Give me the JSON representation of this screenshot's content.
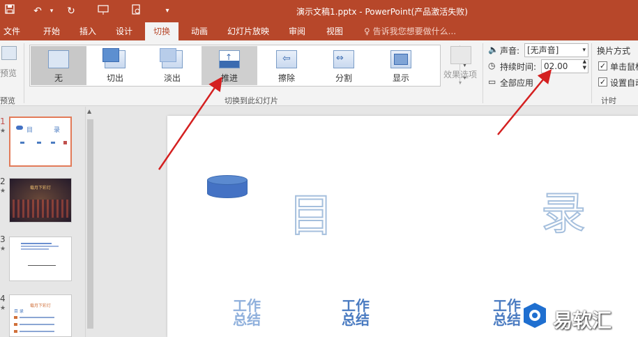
{
  "app": {
    "title": "演示文稿1.pptx - PowerPoint(产品激活失败)",
    "accent": "#b7472a"
  },
  "quick_access": [
    "save-icon",
    "undo-icon",
    "redo-icon",
    "slideshow-from-start-icon",
    "print-preview-icon",
    "customize-icon"
  ],
  "tabs": [
    {
      "label": "文件"
    },
    {
      "label": "开始"
    },
    {
      "label": "插入"
    },
    {
      "label": "设计"
    },
    {
      "label": "切换",
      "active": true
    },
    {
      "label": "动画"
    },
    {
      "label": "幻灯片放映"
    },
    {
      "label": "审阅"
    },
    {
      "label": "视图"
    }
  ],
  "tell_me": "告诉我您想要做什么...",
  "ribbon": {
    "preview": {
      "label": "预览",
      "group": "预览"
    },
    "transitions": [
      {
        "label": "无",
        "state": "selected"
      },
      {
        "label": "切出"
      },
      {
        "label": "淡出"
      },
      {
        "label": "推进",
        "state": "hover"
      },
      {
        "label": "擦除"
      },
      {
        "label": "分割"
      },
      {
        "label": "显示"
      }
    ],
    "effect_options": "效果选项",
    "group_transitions": "切换到此幻灯片",
    "timing": {
      "sound_label": "声音:",
      "sound_value": "[无声音]",
      "duration_label": "持续时间:",
      "duration_value": "02.00",
      "apply_all": "全部应用",
      "advance_label": "换片方式",
      "on_click": "单击鼠标",
      "after": "设置自动",
      "group": "计时"
    }
  },
  "slides": [
    {
      "number": "1",
      "star": "★",
      "title": "目",
      "title2": "录"
    },
    {
      "number": "2",
      "star": "★",
      "title": "载月下彩灯"
    },
    {
      "number": "3",
      "star": "★"
    },
    {
      "number": "4",
      "star": "★",
      "title": "载月下彩灯",
      "subtitle": "目 录"
    }
  ],
  "main_slide": {
    "char1": "目",
    "char2": "录",
    "block1": "工作总结",
    "block2": "工作总结",
    "block3": "工作总结"
  },
  "watermark": {
    "text": "易软汇"
  }
}
